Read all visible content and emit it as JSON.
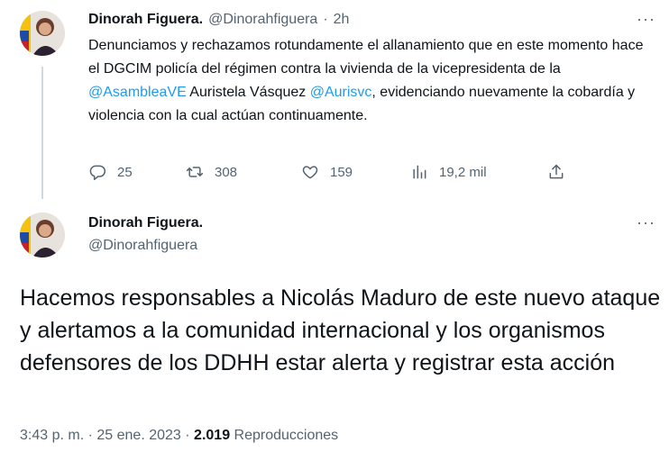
{
  "tweet1": {
    "author_name": "Dinorah Figuera.",
    "handle": "@Dinorahfiguera",
    "separator": "·",
    "time": "2h",
    "more": "···",
    "text_parts": {
      "p1": "Denunciamos y rechazamos rotundamente el  allanamiento que en este momento hace el DGCIM policía del régimen contra la vivienda de la vicepresidenta de la ",
      "m1": "@AsambleaVE",
      "p2": " Auristela Vásquez ",
      "m2": "@Aurisvc",
      "p3": ", evidenciando nuevamente la cobardía y violencia con la cual actúan continuamente."
    },
    "actions": {
      "replies": "25",
      "retweets": "308",
      "likes": "159",
      "views": "19,2 mil"
    }
  },
  "tweet2": {
    "author_name": "Dinorah Figuera.",
    "handle": "@Dinorahfiguera",
    "more": "···",
    "text": "Hacemos responsables a Nicolás Maduro de este nuevo ataque y alertamos a la comunidad internacional y los organismos defensores de los DDHH estar alerta y registrar esta acción",
    "meta": {
      "time": "3:43 p. m.",
      "sep1": "·",
      "date": "25 ene. 2023",
      "sep2": "·",
      "views_count": "2.019",
      "views_label": "Reproducciones"
    }
  },
  "colors": {
    "text": "#0f1419",
    "secondary": "#536471",
    "link": "#1d9bf0",
    "thread_line": "#cfd9de"
  },
  "icons": [
    "reply-icon",
    "retweet-icon",
    "like-icon",
    "views-icon",
    "share-icon",
    "more-icon"
  ]
}
